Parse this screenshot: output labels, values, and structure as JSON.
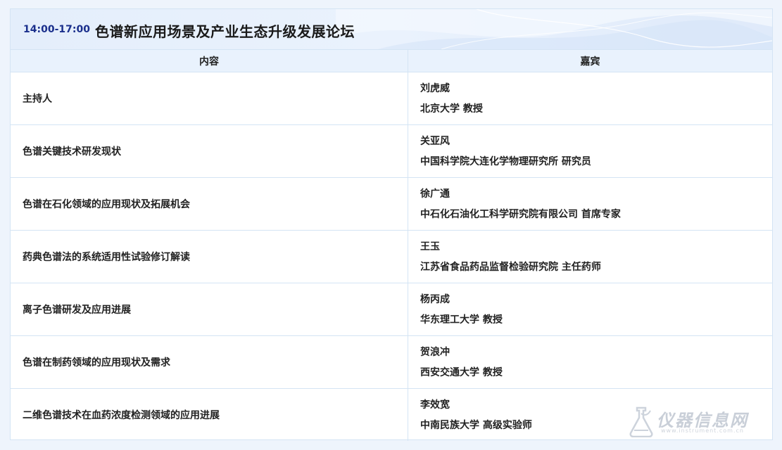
{
  "header": {
    "time": "14:00-17:00",
    "title": "色谱新应用场景及产业生态升级发展论坛"
  },
  "columns": {
    "content": "内容",
    "guest": "嘉宾"
  },
  "rows": [
    {
      "content": "主持人",
      "name": "刘虎威",
      "affiliation": "北京大学 教授"
    },
    {
      "content": "色谱关键技术研发现状",
      "name": "关亚风",
      "affiliation": "中国科学院大连化学物理研究所 研究员"
    },
    {
      "content": "色谱在石化领域的应用现状及拓展机会",
      "name": "徐广通",
      "affiliation": "中石化石油化工科学研究院有限公司 首席专家"
    },
    {
      "content": "药典色谱法的系统适用性试验修订解读",
      "name": "王玉",
      "affiliation": "江苏省食品药品监督检验研究院 主任药师"
    },
    {
      "content": "离子色谱研发及应用进展",
      "name": "杨丙成",
      "affiliation": "华东理工大学 教授"
    },
    {
      "content": "色谱在制药领域的应用现状及需求",
      "name": "贺浪冲",
      "affiliation": "西安交通大学 教授"
    },
    {
      "content": "二维色谱技术在血药浓度检测领域的应用进展",
      "name": "李效宽",
      "affiliation": "中南民族大学 高级实验师"
    }
  ],
  "watermark": {
    "text": "仪器信息网",
    "url": "www.instrument.com.cn",
    "icon": "flask-logo-icon"
  },
  "colors": {
    "time": "#1a2f8c",
    "border": "#d4e4f4",
    "header_bg": "#e9f2fd"
  }
}
